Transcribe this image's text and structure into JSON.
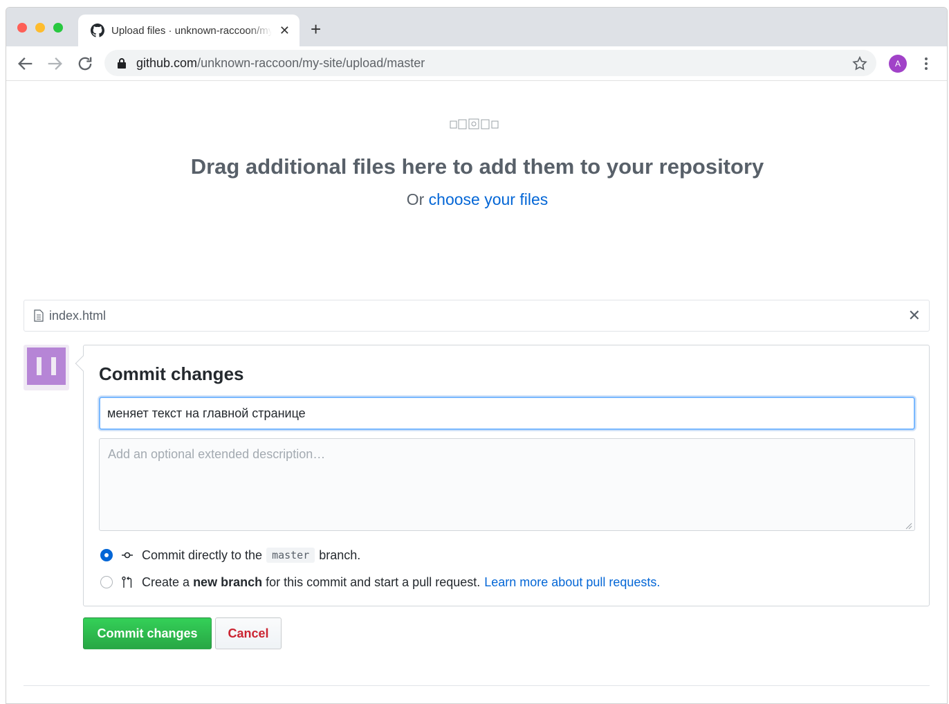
{
  "browser": {
    "tab_title": "Upload files · unknown-raccoon/my-site",
    "tab_close": "✕",
    "new_tab": "+",
    "url_host": "github.com",
    "url_path": "/unknown-raccoon/my-site/upload/master",
    "profile_initial": "A"
  },
  "dropzone": {
    "title": "Drag additional files here to add them to your repository",
    "or_text": "Or ",
    "choose_link": "choose your files"
  },
  "file": {
    "name": "index.html",
    "remove": "✕"
  },
  "commit": {
    "title": "Commit changes",
    "summary_value": "меняет текст на главной странице",
    "description_placeholder": "Add an optional extended description…",
    "option_direct": {
      "prefix": "Commit directly to the",
      "branch": "master",
      "suffix": "branch."
    },
    "option_new_branch": {
      "prefix": "Create a",
      "bold": "new branch",
      "suffix": "for this commit and start a pull request.",
      "link": "Learn more about pull requests."
    },
    "submit_label": "Commit changes",
    "cancel_label": "Cancel"
  },
  "colors": {
    "link": "#0366d6",
    "commit_button": "#28a745",
    "cancel_text": "#cb2431",
    "avatar_purple": "#b685d6"
  }
}
